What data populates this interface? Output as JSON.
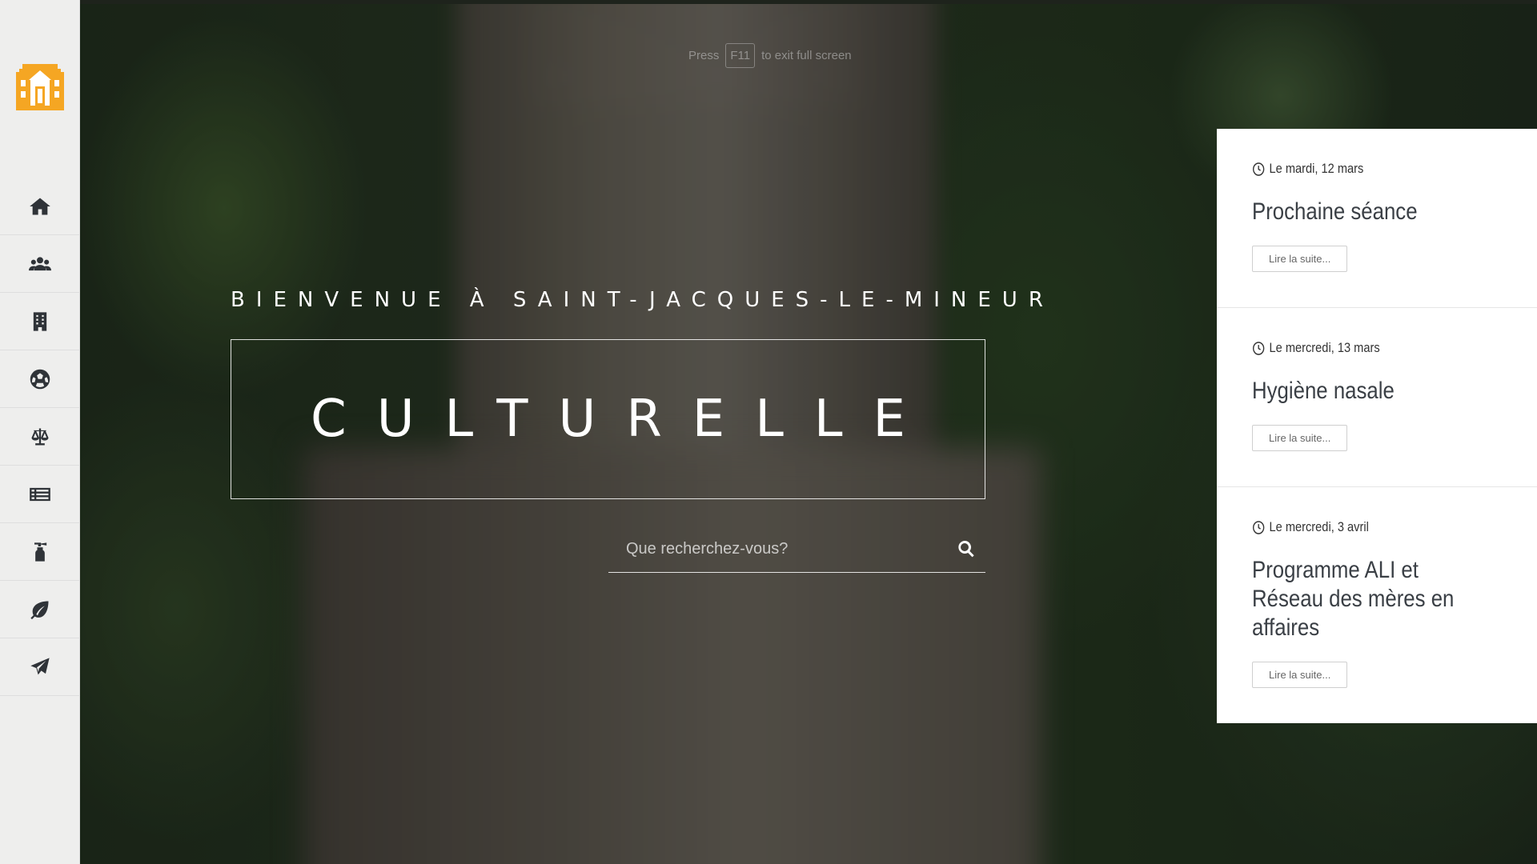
{
  "fullscreen_hint": {
    "prefix": "Press",
    "key": "F11",
    "suffix": "to exit full screen"
  },
  "sidebar": {
    "logo": "town-hall-logo",
    "items": [
      {
        "icon": "home-icon"
      },
      {
        "icon": "users-icon"
      },
      {
        "icon": "building-icon"
      },
      {
        "icon": "soccer-ball-icon"
      },
      {
        "icon": "scales-icon"
      },
      {
        "icon": "list-icon"
      },
      {
        "icon": "fire-extinguisher-icon"
      },
      {
        "icon": "leaf-icon"
      },
      {
        "icon": "paper-plane-icon"
      }
    ]
  },
  "hero": {
    "welcome": "BIENVENUE À SAINT-JACQUES-LE-MINEUR",
    "title": "CULTURELLE",
    "search_placeholder": "Que recherchez-vous?",
    "search_icon": "search-icon"
  },
  "events": [
    {
      "date": "Le mardi, 12 mars",
      "title": "Prochaine séance",
      "button": "Lire la suite..."
    },
    {
      "date": "Le mercredi, 13 mars",
      "title": "Hygiène nasale",
      "button": "Lire la suite..."
    },
    {
      "date": "Le mercredi, 3 avril",
      "title": "Programme ALI et Réseau des mères en affaires",
      "button": "Lire la suite..."
    }
  ],
  "colors": {
    "sidebar_bg": "#eeeeed",
    "icon": "#2f3338",
    "logo_orange": "#f5a623",
    "panel_bg": "#ffffff",
    "text_white": "#ffffff"
  }
}
